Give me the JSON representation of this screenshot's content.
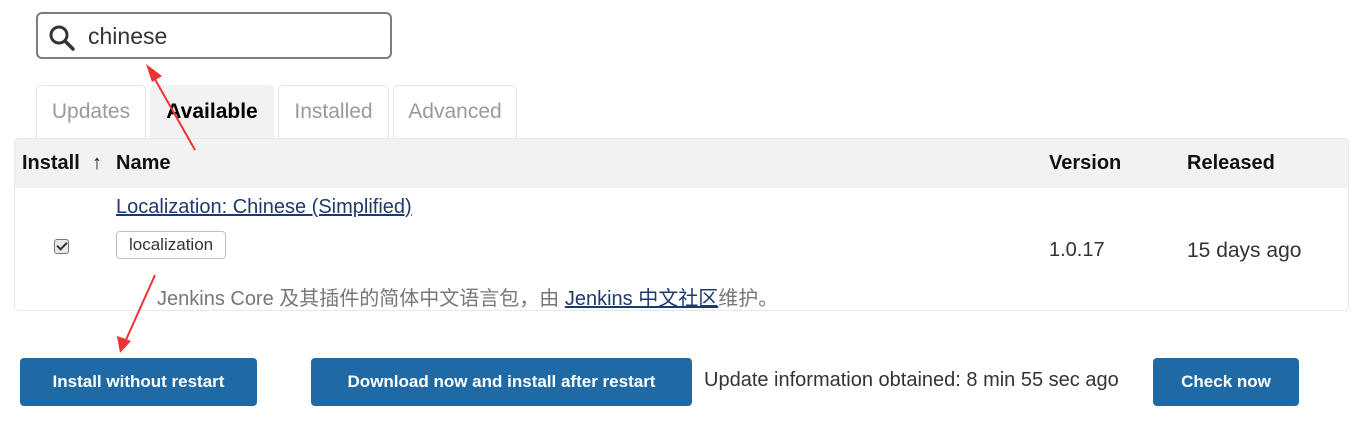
{
  "search": {
    "value": "chinese",
    "icon": "search-icon"
  },
  "tabs": [
    {
      "label": "Updates",
      "active": false
    },
    {
      "label": "Available",
      "active": true
    },
    {
      "label": "Installed",
      "active": false
    },
    {
      "label": "Advanced",
      "active": false
    }
  ],
  "table": {
    "headers": {
      "install": "Install",
      "sort_indicator": "↑",
      "name": "Name",
      "version": "Version",
      "released": "Released"
    },
    "rows": [
      {
        "checked": true,
        "name": "Localization: Chinese (Simplified)",
        "tag": "localization",
        "description_prefix": "Jenkins Core 及其插件的简体中文语言包，由 ",
        "description_link": "Jenkins 中文社区",
        "description_suffix": "维护。",
        "version": "1.0.17",
        "released": "15 days ago"
      }
    ]
  },
  "actions": {
    "install_without_restart": "Install without restart",
    "download_install_after_restart": "Download now and install after restart",
    "update_info": "Update information obtained: 8 min 55 sec ago",
    "check_now": "Check now"
  },
  "colors": {
    "primary_button": "#1f6aa5",
    "link": "#1d3a6e",
    "annotation_arrow": "#ee3333",
    "header_bg": "#f2f2f2"
  }
}
